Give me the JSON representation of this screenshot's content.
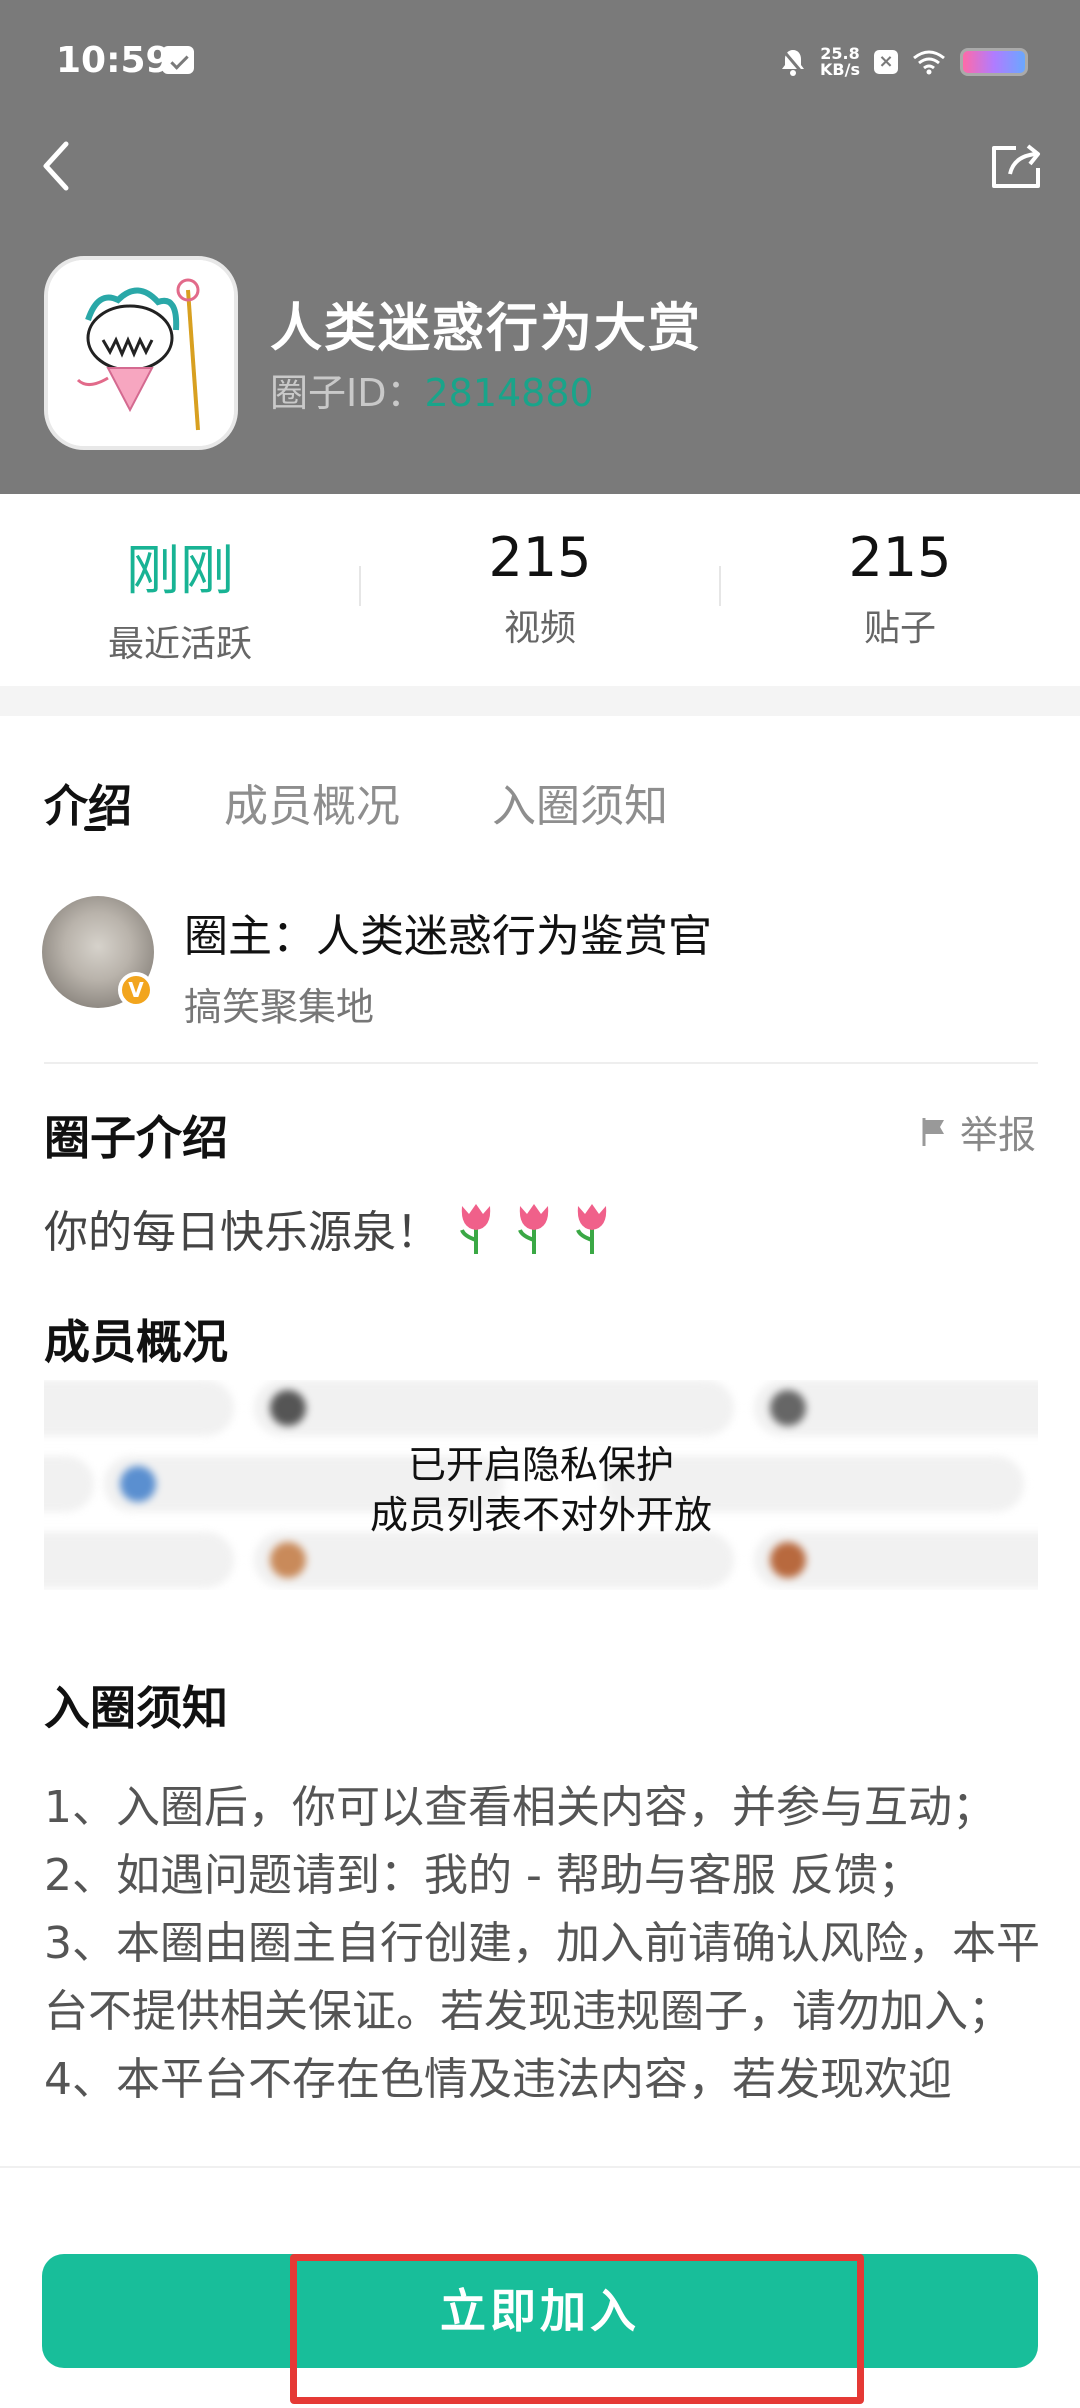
{
  "status_bar": {
    "time": "10:59",
    "net_speed_value": "25.8",
    "net_speed_unit": "KB/s"
  },
  "circle": {
    "title": "人类迷惑行为大赏",
    "id_label": "圈子ID：",
    "id_value": "2814880"
  },
  "stats": [
    {
      "value": "刚刚",
      "label": "最近活跃"
    },
    {
      "value": "215",
      "label": "视频"
    },
    {
      "value": "215",
      "label": "贴子"
    }
  ],
  "tabs": [
    "介绍",
    "成员概况",
    "入圈须知"
  ],
  "owner": {
    "name": "圈主：人类迷惑行为鉴赏官",
    "subtitle": "搞笑聚集地"
  },
  "intro": {
    "title": "圈子介绍",
    "report_label": "举报",
    "text": "你的每日快乐源泉！"
  },
  "members": {
    "title": "成员概况",
    "privacy_line1": "已开启隐私保护",
    "privacy_line2": "成员列表不对外开放"
  },
  "rules": {
    "title": "入圈须知",
    "lines": [
      "1、入圈后，你可以查看相关内容，并参与互动；",
      "2、如遇问题请到：我的 - 帮助与客服 反馈；",
      "3、本圈由圈主自行创建，加入前请确认风险，本平台不提供相关保证。若发现违规圈子，请勿加入；",
      "4、本平台不存在色情及违法内容，若发现欢迎"
    ]
  },
  "join_button": "立即加入",
  "colors": {
    "accent": "#18be9a",
    "header_bg": "#7a7a7a",
    "highlight": "#e53935"
  }
}
